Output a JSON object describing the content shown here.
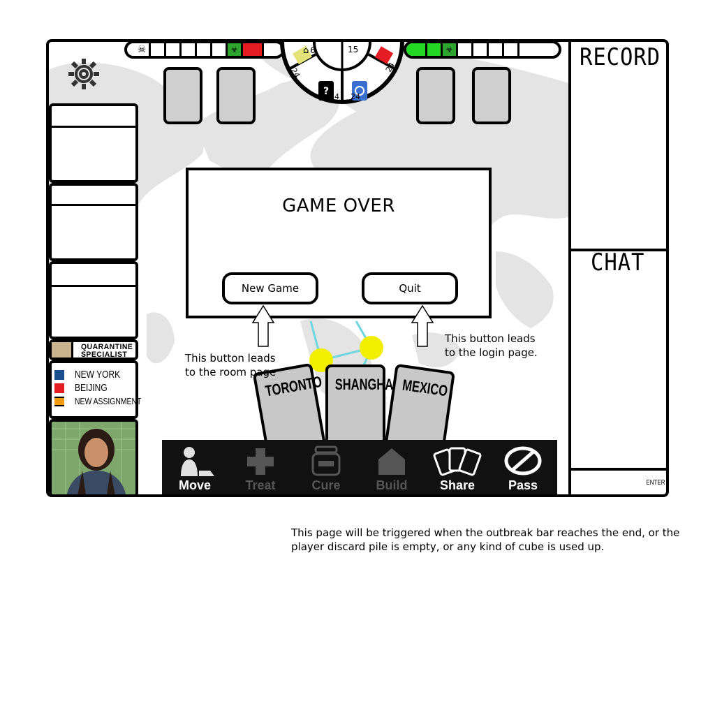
{
  "sidebar": {
    "role_name_line1": "QUARANTINE",
    "role_name_line2": "SPECIALIST",
    "cities": [
      {
        "name": "NEW YORK",
        "color": "#1c4f8f"
      },
      {
        "name": "BEIJING",
        "color": "#e51c23"
      },
      {
        "name": "NEW ASSIGNMENT",
        "color": "#f39c12"
      }
    ]
  },
  "supply": {
    "research_stations": "6",
    "player_deck": "15",
    "yellow_cubes": "24",
    "black_cubes": "24",
    "blue_cubes": "24",
    "red_cubes": "24"
  },
  "outbreak_track": {
    "filled": 1,
    "cells": 6
  },
  "infection_track": {
    "filled": 3,
    "cells": 6
  },
  "record_panel": {
    "title": "RECORD"
  },
  "chat_panel": {
    "title": "CHAT",
    "enter_label": "ENTER"
  },
  "dialog": {
    "title": "GAME OVER",
    "new_game_label": "New Game",
    "quit_label": "Quit"
  },
  "annotations": {
    "new_game_note_line1": "This button leads",
    "new_game_note_line2": "to the room page",
    "quit_note_line1": "This button leads",
    "quit_note_line2": "to the login page.",
    "trigger_note_line1": "This page will be triggered when the outbreak bar reaches the end, or the",
    "trigger_note_line2": "player discard pile is empty, or any kind of cube is used up."
  },
  "hand_cards": [
    "TORONTO",
    "SHANGHAI",
    "MEXICO"
  ],
  "actions": [
    {
      "label": "Move",
      "enabled": true
    },
    {
      "label": "Treat",
      "enabled": false
    },
    {
      "label": "Cure",
      "enabled": false
    },
    {
      "label": "Build",
      "enabled": false
    },
    {
      "label": "Share",
      "enabled": true
    },
    {
      "label": "Pass",
      "enabled": true
    }
  ],
  "colors": {
    "outbreak": "#e51c23",
    "infection": "#22d822",
    "city_node": "#f2ee00",
    "route": "#6fd6e0"
  }
}
